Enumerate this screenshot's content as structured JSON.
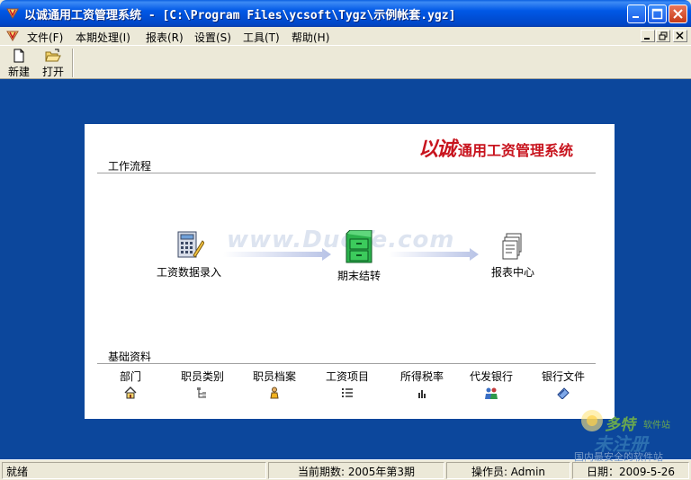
{
  "window": {
    "title": "以诚通用工资管理系统 - [C:\\Program Files\\ycsoft\\Tygz\\示例帐套.ygz]"
  },
  "menu": {
    "items": [
      {
        "label": "文件(F)"
      },
      {
        "label": "本期处理(I)"
      },
      {
        "label": "报表(R)"
      },
      {
        "label": "设置(S)"
      },
      {
        "label": "工具(T)"
      },
      {
        "label": "帮助(H)"
      }
    ]
  },
  "toolbar": {
    "new_label": "新建",
    "open_label": "打开"
  },
  "panel": {
    "brand_logo": "以诚",
    "brand_name": "通用工资管理系统",
    "workflow_title": "工作流程",
    "watermark": "www.DuoTe.com",
    "flow": [
      {
        "label": "工资数据录入"
      },
      {
        "label": "期末结转"
      },
      {
        "label": "报表中心"
      }
    ],
    "basic_title": "基础资料",
    "basic": [
      {
        "label": "部门"
      },
      {
        "label": "职员类别"
      },
      {
        "label": "职员档案"
      },
      {
        "label": "工资项目"
      },
      {
        "label": "所得税率"
      },
      {
        "label": "代发银行"
      },
      {
        "label": "银行文件"
      }
    ]
  },
  "status": {
    "ready": "就绪",
    "period": "当前期数: 2005年第3期",
    "operator": "操作员: Admin",
    "date": "日期：2009-5-26"
  },
  "corner_watermark": {
    "line1": "多特",
    "line1b": "软件站",
    "line2": "未注册",
    "line3": "国内最安全的软件站"
  }
}
